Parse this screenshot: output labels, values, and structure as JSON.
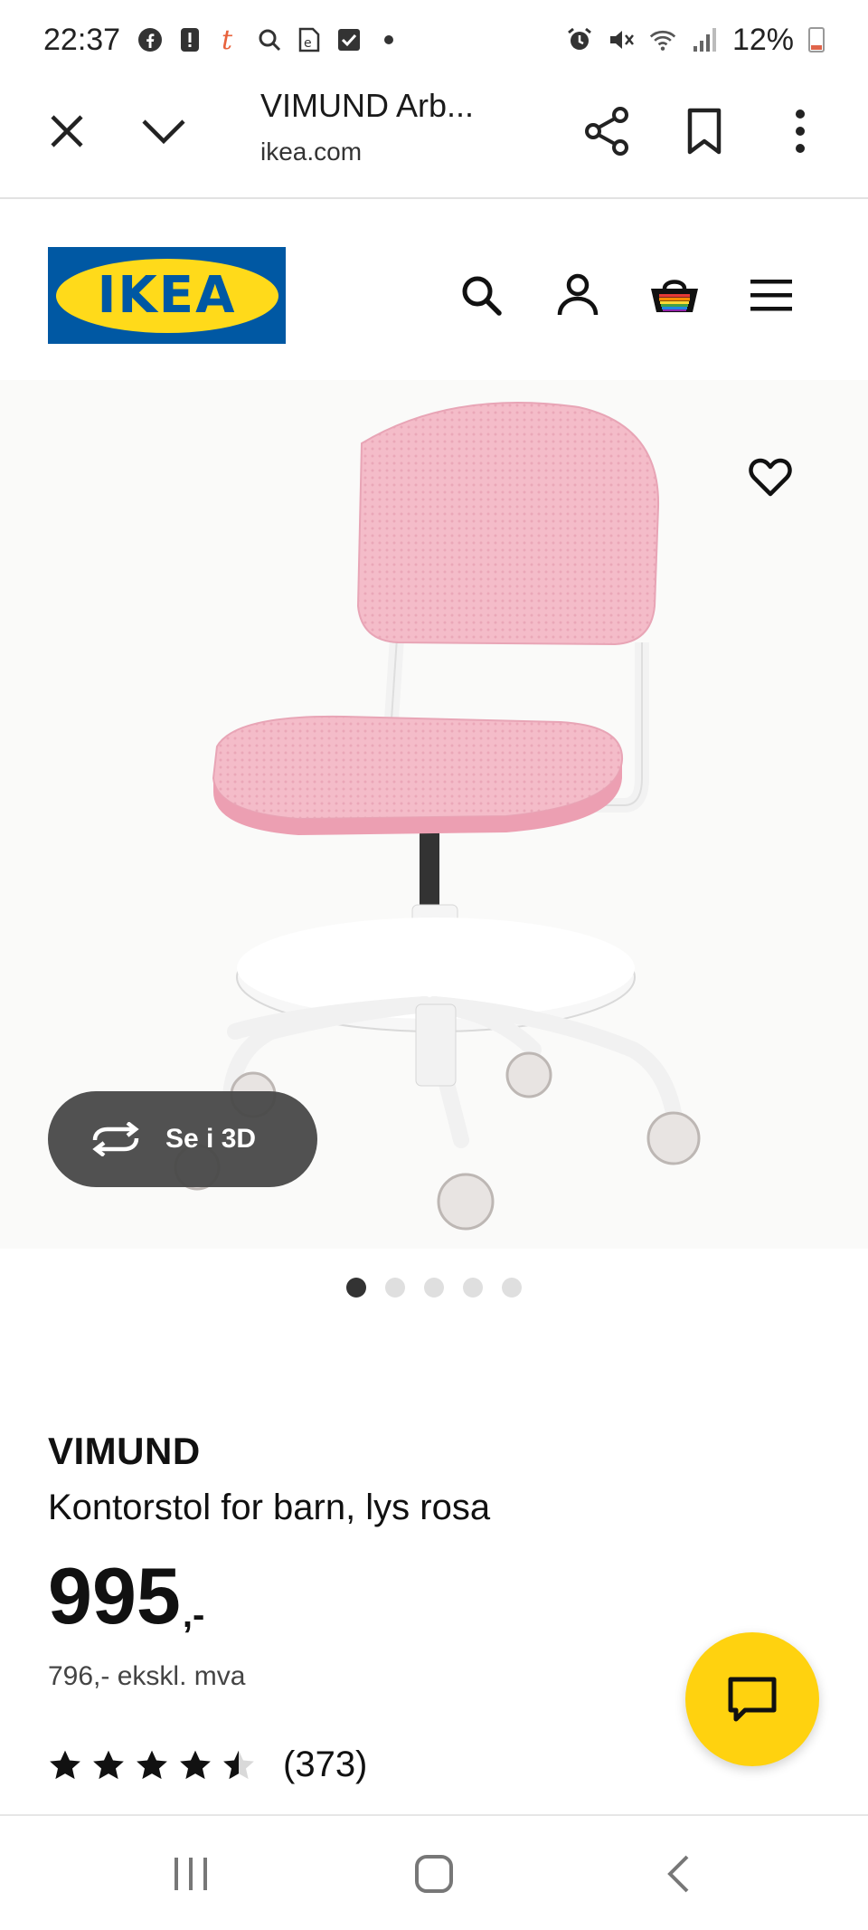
{
  "status_bar": {
    "time": "22:37",
    "battery": "12%",
    "left_icons": [
      "facebook-icon",
      "alert-icon",
      "t-app-icon",
      "search-icon",
      "e-doc-icon",
      "checkbox-icon",
      "dot-icon"
    ],
    "right_icons": [
      "alarm-icon",
      "mute-icon",
      "wifi-icon",
      "signal-icon",
      "battery-icon"
    ]
  },
  "toolbar": {
    "title": "VIMUND Arb...",
    "url": "ikea.com",
    "icons": [
      "close-icon",
      "chevron-down-icon",
      "share-icon",
      "bookmark-icon",
      "more-vert-icon"
    ]
  },
  "header": {
    "logo_text": "IKEA",
    "icons": [
      "search-icon",
      "user-icon",
      "basket-icon",
      "menu-icon"
    ]
  },
  "gallery": {
    "view_3d_label": "Se i 3D",
    "dots_total": 5,
    "active_index": 0
  },
  "product": {
    "name": "VIMUND",
    "description": "Kontorstol for barn, lys rosa",
    "price": "995",
    "price_suffix": ",-",
    "price_ex_vat": "796,- ekskl. mva",
    "rating": 4.5,
    "review_count": "(373)"
  },
  "colors": {
    "ikea_blue": "#0058a3",
    "ikea_yellow": "#ffda1a",
    "chat_yellow": "#ffd20f",
    "chair_pink": "#f3b8c6"
  }
}
